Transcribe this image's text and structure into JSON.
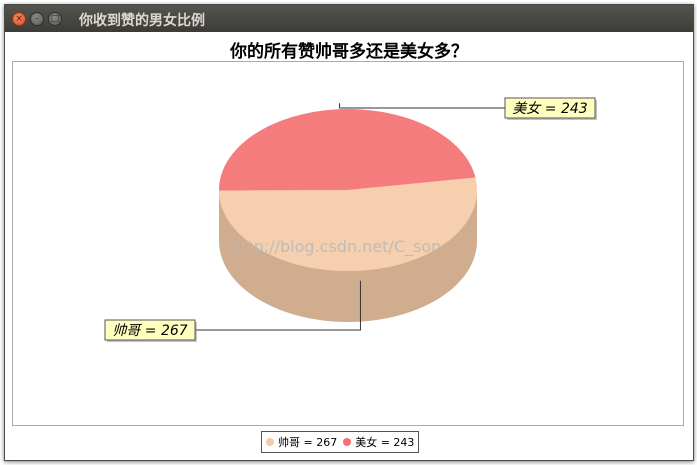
{
  "window": {
    "title": "你收到赞的男女比例",
    "controls": {
      "close": "×",
      "minimize": "–",
      "maximize": "□"
    }
  },
  "chart_data": {
    "type": "pie",
    "title": "你的所有赞帅哥多还是美女多？",
    "style": "3d",
    "slices": [
      {
        "name": "帅哥",
        "value": 267,
        "label": "帅哥 = 267",
        "color": "#f4cba7"
      },
      {
        "name": "美女",
        "value": 243,
        "label": "美女 = 243",
        "color": "#f47171"
      }
    ],
    "legend_position": "bottom"
  },
  "watermark": "http://blog.csdn.net/C_son"
}
